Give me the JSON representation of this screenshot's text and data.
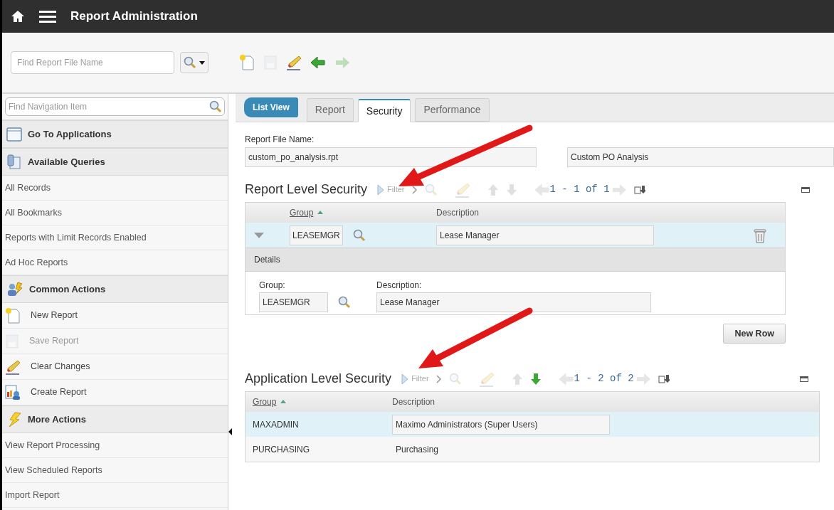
{
  "header": {
    "title": "Report Administration"
  },
  "toolbar": {
    "search": {
      "placeholder": "Find Report File Name"
    },
    "buttons": [
      {
        "enabled": true
      },
      {
        "enabled": false
      },
      {
        "enabled": true
      },
      {
        "enabled": true
      },
      {
        "enabled": false
      }
    ]
  },
  "sidebar": {
    "search": {
      "placeholder": "Find Navigation Item"
    },
    "items": [
      {
        "kind": "header",
        "label": "Go To Applications"
      },
      {
        "kind": "header",
        "label": "Available Queries"
      },
      {
        "kind": "link",
        "label": "All Records"
      },
      {
        "kind": "link",
        "label": "All Bookmarks"
      },
      {
        "kind": "link",
        "label": "Reports with Limit Records Enabled"
      },
      {
        "kind": "link",
        "label": "Ad Hoc Reports"
      },
      {
        "kind": "header",
        "label": "Common Actions"
      },
      {
        "kind": "action",
        "label": "New Report",
        "disabled": false
      },
      {
        "kind": "action",
        "label": "Save Report",
        "disabled": true
      },
      {
        "kind": "action",
        "label": "Clear Changes",
        "disabled": false
      },
      {
        "kind": "action",
        "label": "Create Report",
        "disabled": false
      },
      {
        "kind": "header",
        "label": "More Actions"
      },
      {
        "kind": "link",
        "label": "View Report Processing"
      },
      {
        "kind": "link",
        "label": "View Scheduled Reports"
      },
      {
        "kind": "link",
        "label": "Import Report"
      }
    ]
  },
  "list_view_button": {
    "label": "List View"
  },
  "tabs": [
    {
      "label": "Report",
      "selected": false
    },
    {
      "label": "Security",
      "selected": true
    },
    {
      "label": "Performance",
      "selected": false
    }
  ],
  "form": {
    "label": "Report File Name:",
    "value": "custom_po_analysis.rpt",
    "description": "Custom PO Analysis"
  },
  "sections": [
    {
      "kind": "editable",
      "title": "Report Level Security",
      "filter_label": "Filter",
      "pagination": "1 - 1 of 1",
      "down_enabled": false,
      "columns": [
        "Group",
        "Description"
      ],
      "rows": [
        {
          "group": "LEASEMGR",
          "description": "Lease Manager",
          "selected": true,
          "expanded": true
        }
      ],
      "details": {
        "title": "Details",
        "fields": [
          {
            "label": "Group:",
            "value": "LEASEMGR"
          },
          {
            "label": "Description:",
            "value": "Lease Manager"
          }
        ]
      },
      "new_row_button": "New Row"
    },
    {
      "kind": "list",
      "title": "Application Level Security",
      "filter_label": "Filter",
      "pagination": "1 - 2 of 2",
      "down_enabled": true,
      "columns": [
        "Group",
        "Description"
      ],
      "rows": [
        {
          "group": "MAXADMIN",
          "description": "Maximo Administrators (Super Users)",
          "selected": true
        },
        {
          "group": "PURCHASING",
          "description": "Purchasing",
          "selected": false
        }
      ]
    }
  ]
}
